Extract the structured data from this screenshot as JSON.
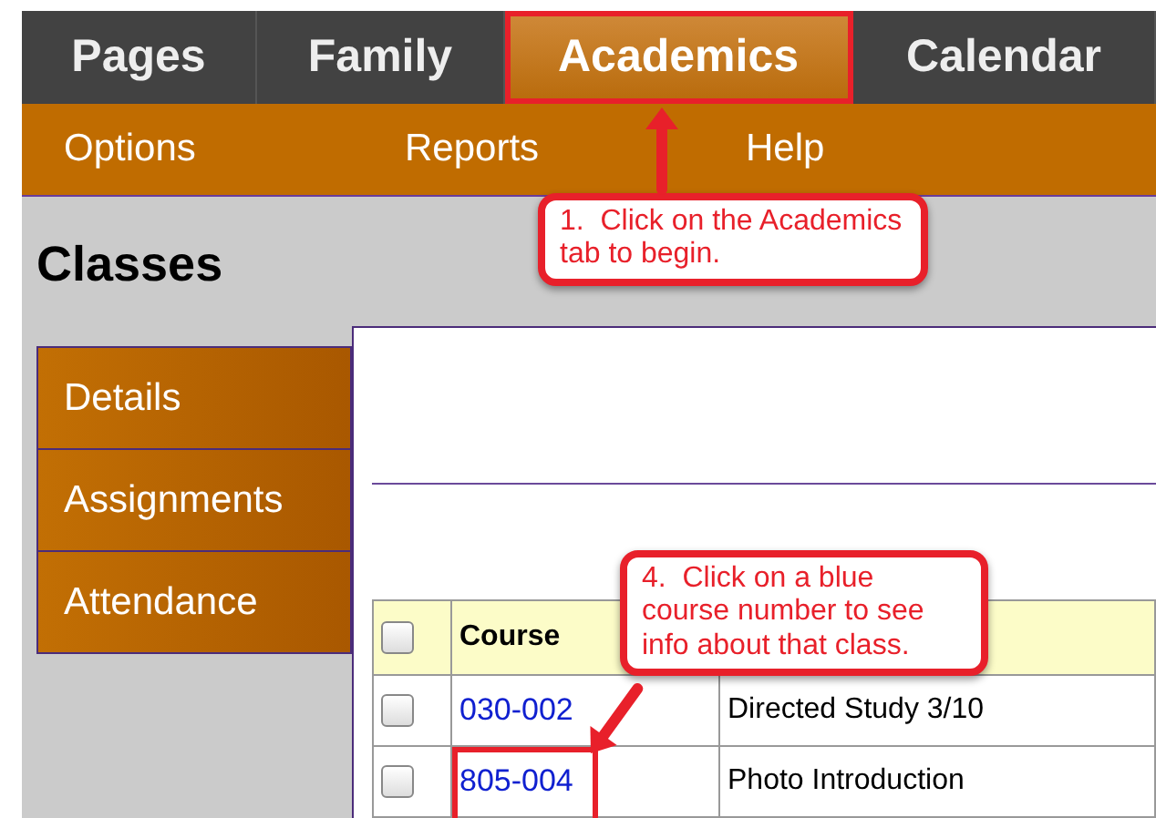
{
  "top_tabs": [
    {
      "label": "Pages",
      "selected": false
    },
    {
      "label": "Family",
      "selected": false
    },
    {
      "label": "Academics",
      "selected": true
    },
    {
      "label": "Calendar",
      "selected": false
    }
  ],
  "sub_menu": [
    "Options",
    "Reports",
    "Help"
  ],
  "page_title": "Classes",
  "sidebar": {
    "items": [
      {
        "label": "Details"
      },
      {
        "label": "Assignments"
      },
      {
        "label": "Attendance"
      }
    ]
  },
  "table": {
    "select_all": {
      "checked": false
    },
    "columns": [
      "Course"
    ],
    "rows": [
      {
        "checked": false,
        "course": "030-002",
        "column_2": "Directed Study 3/10"
      },
      {
        "checked": false,
        "course": "805-004",
        "column_2": "Photo Introduction"
      }
    ]
  },
  "annotations": [
    {
      "kind": "tab",
      "text": "1.  Click on the Academics tab to begin."
    },
    {
      "kind": "course",
      "text": "4.  Click on a blue course number to see info about that class."
    }
  ]
}
